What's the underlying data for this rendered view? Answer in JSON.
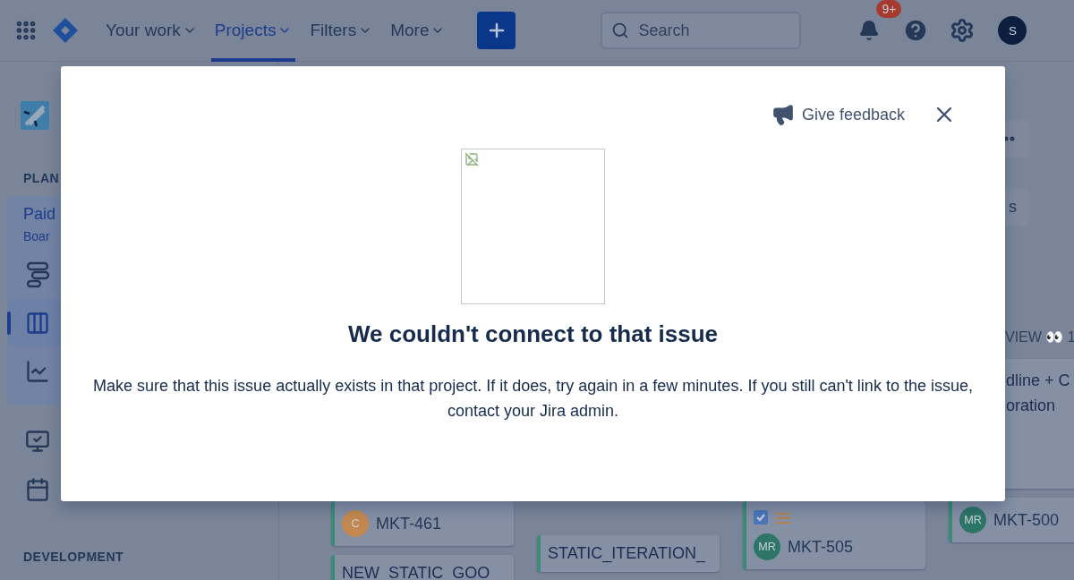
{
  "nav": {
    "items": [
      {
        "label": "Your work",
        "selected": false
      },
      {
        "label": "Projects",
        "selected": true
      },
      {
        "label": "Filters",
        "selected": false
      },
      {
        "label": "More",
        "selected": false
      }
    ],
    "search": {
      "placeholder": "Search"
    },
    "notification_count": "9+",
    "avatar": "S"
  },
  "sidebar": {
    "plan_heading": "PLAN",
    "project": {
      "name": "Paid",
      "subtitle": "Boar"
    },
    "planning_icons": [
      {
        "kind": "timeline",
        "selected": false
      },
      {
        "kind": "board",
        "selected": true
      },
      {
        "kind": "reports",
        "selected": false
      }
    ],
    "other_icons": [
      {
        "kind": "issues",
        "selected": false
      },
      {
        "kind": "components",
        "selected": false
      }
    ],
    "development_heading": "DEVELOPMENT"
  },
  "board": {
    "action_label": "s",
    "columns": [
      {
        "cards": [
          {
            "kind": "issue",
            "avatar": "C",
            "color": "#c4874d",
            "key": "MKT-461"
          },
          {
            "kind": "title",
            "title": "NEW_STATIC_GOO"
          }
        ]
      },
      {
        "cards": [
          {
            "kind": "title",
            "title": "STATIC_ITERATION_"
          }
        ]
      },
      {
        "cards": [
          {
            "kind": "checked_issue",
            "avatar": "MR",
            "color": "#2d7566",
            "key": "MKT-505"
          }
        ]
      },
      {
        "heading": "VIEW 👀 1",
        "cards": [
          {
            "kind": "text",
            "lines": [
              "dline + C",
              "oration"
            ]
          },
          {
            "kind": "issue",
            "avatar": "MR",
            "color": "#2d7566",
            "key": "MKT-500"
          }
        ]
      }
    ]
  },
  "dialog": {
    "feedback": "Give feedback",
    "title": "We couldn't connect to that issue",
    "message": "Make sure that this issue actually exists in that project. If it does, try again in a few minutes. If you still can't link to the issue, contact your Jira admin."
  }
}
